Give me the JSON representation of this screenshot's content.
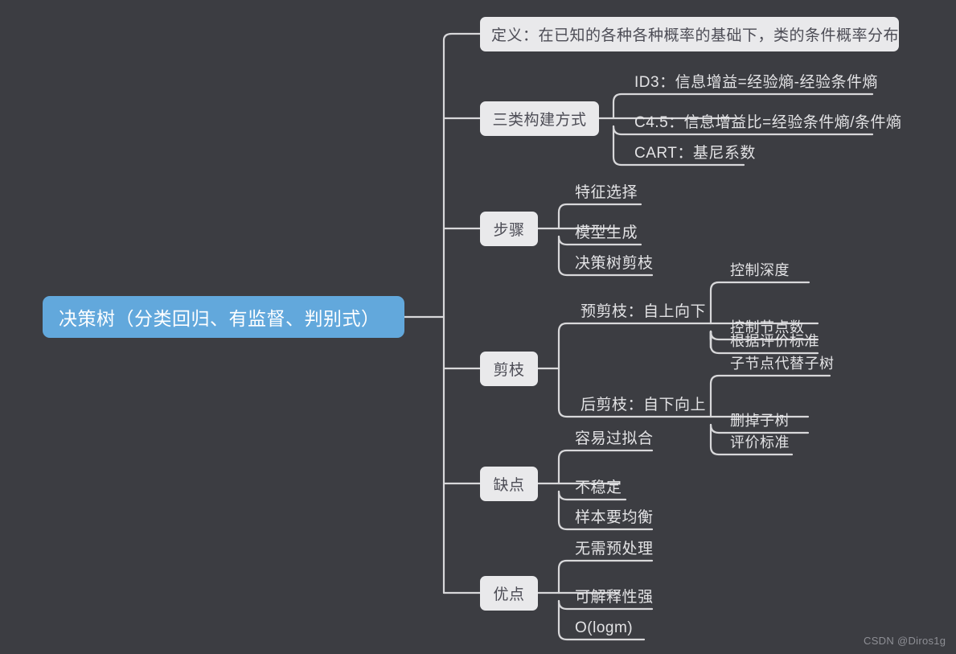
{
  "theme": {
    "background": "#3c3d42",
    "root_fill": "#62a8dc",
    "root_text": "#ffffff",
    "topic_fill": "#e9e9eb",
    "topic_text": "#4c4c55",
    "leaf_text": "#e3e3e5",
    "line_color": "#d8d8da",
    "watermark_color": "#8e8f95"
  },
  "mindmap": {
    "root": {
      "label": "决策树（分类回归、有监督、判别式）"
    },
    "branches": [
      {
        "label": "定义：在已知的各种各种概率的基础下，类的条件概率分布",
        "kind": "topic-wide",
        "children": []
      },
      {
        "label": "三类构建方式",
        "kind": "topic",
        "children": [
          {
            "label": "ID3：信息增益=经验熵-经验条件熵"
          },
          {
            "label": "C4.5：信息增益比=经验条件熵/条件熵"
          },
          {
            "label": "CART：基尼系数"
          }
        ]
      },
      {
        "label": "步骤",
        "kind": "topic",
        "children": [
          {
            "label": "特征选择"
          },
          {
            "label": "模型生成"
          },
          {
            "label": "决策树剪枝"
          }
        ]
      },
      {
        "label": "剪枝",
        "kind": "topic",
        "children": [
          {
            "label": "预剪枝：自上向下",
            "children": [
              {
                "label": "控制深度"
              },
              {
                "label": "控制节点数"
              },
              {
                "label": "根据评价标准"
              }
            ]
          },
          {
            "label": "后剪枝：自下向上",
            "children": [
              {
                "label": "子节点代替子树"
              },
              {
                "label": "删掉子树"
              },
              {
                "label": "评价标准"
              }
            ]
          }
        ]
      },
      {
        "label": "缺点",
        "kind": "topic",
        "children": [
          {
            "label": "容易过拟合"
          },
          {
            "label": "不稳定"
          },
          {
            "label": "样本要均衡"
          }
        ]
      },
      {
        "label": "优点",
        "kind": "topic",
        "children": [
          {
            "label": "无需预处理"
          },
          {
            "label": "可解释性强"
          },
          {
            "label": "O(logm)"
          }
        ]
      }
    ]
  },
  "watermark": {
    "text": "CSDN @Diros1g"
  }
}
